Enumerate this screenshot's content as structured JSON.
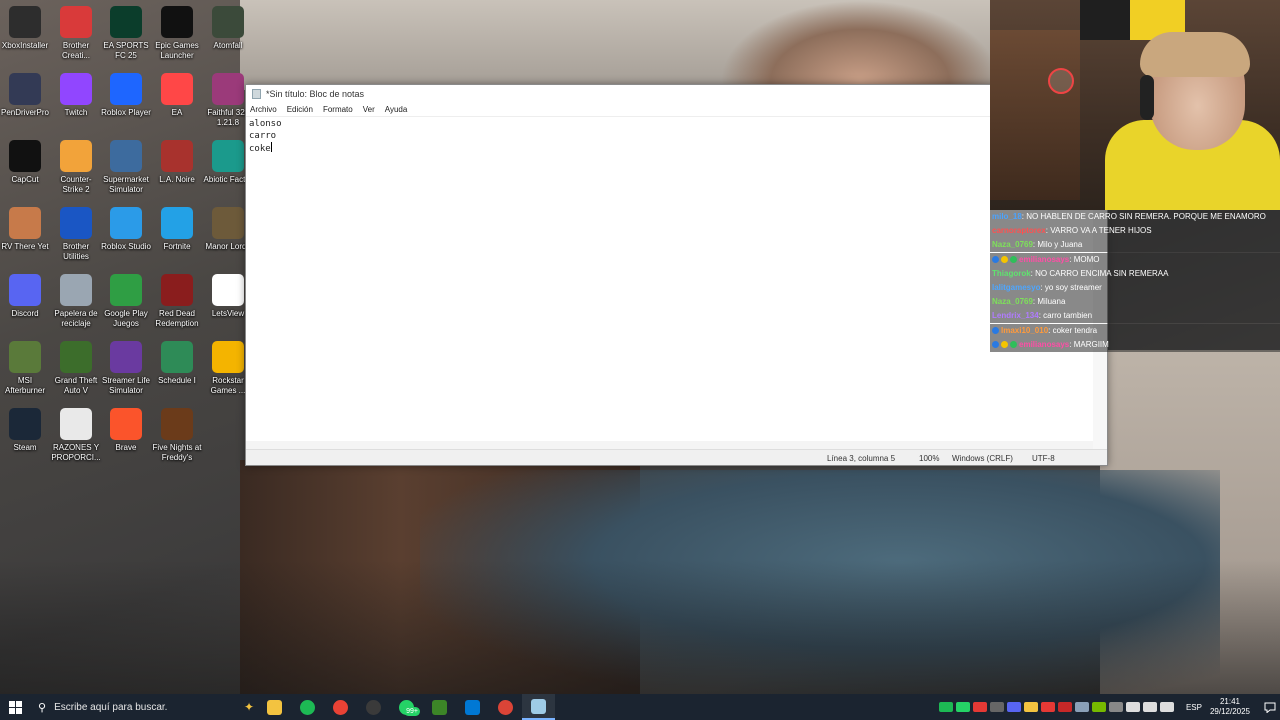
{
  "desktop_icons": [
    {
      "label": "XboxInstaller",
      "icon": "xbox-icon",
      "color": "#2d2d2d"
    },
    {
      "label": "Brother Creati...",
      "icon": "brother-creative-icon",
      "color": "#d93a3a"
    },
    {
      "label": "EA SPORTS FC 25",
      "icon": "ea-fc-icon",
      "color": "#0b3d2b"
    },
    {
      "label": "Epic Games Launcher",
      "icon": "epic-games-icon",
      "color": "#111111"
    },
    {
      "label": "Atomfall",
      "icon": "atomfall-icon",
      "color": "#3b4a3a"
    },
    {
      "label": "PenDriverPro",
      "icon": "unreal-icon",
      "color": "#333a55"
    },
    {
      "label": "Twitch",
      "icon": "twitch-icon",
      "color": "#9146ff"
    },
    {
      "label": "Roblox Player",
      "icon": "roblox-icon",
      "color": "#1e66ff"
    },
    {
      "label": "EA",
      "icon": "ea-icon",
      "color": "#ff4747"
    },
    {
      "label": "Faithful 32x 1.21.8",
      "icon": "winrar-icon",
      "color": "#9b3a7a"
    },
    {
      "label": "CapCut",
      "icon": "capcut-icon",
      "color": "#111111"
    },
    {
      "label": "Counter-Strike 2",
      "icon": "cs2-icon",
      "color": "#f2a33a"
    },
    {
      "label": "Supermarket Simulator",
      "icon": "supermarket-icon",
      "color": "#3d6b9e"
    },
    {
      "label": "L.A. Noire",
      "icon": "la-noire-icon",
      "color": "#a8322d"
    },
    {
      "label": "Abiotic Factor",
      "icon": "abiotic-factor-icon",
      "color": "#1b9a8c"
    },
    {
      "label": "RV There Yet",
      "icon": "rv-there-yet-icon",
      "color": "#c77a4a"
    },
    {
      "label": "Brother Utilities",
      "icon": "brother-utilities-icon",
      "color": "#1a56c4"
    },
    {
      "label": "Roblox Studio",
      "icon": "roblox-studio-icon",
      "color": "#2b9be8"
    },
    {
      "label": "Fortnite",
      "icon": "fortnite-icon",
      "color": "#23a1e6"
    },
    {
      "label": "Manor Lords",
      "icon": "manor-lords-icon",
      "color": "#6d5a3a"
    },
    {
      "label": "Discord",
      "icon": "discord-icon",
      "color": "#5865f2"
    },
    {
      "label": "Papelera de reciclaje",
      "icon": "recycle-bin-icon",
      "color": "#9aa6b2"
    },
    {
      "label": "Google Play Juegos",
      "icon": "google-play-games-icon",
      "color": "#2f9e44"
    },
    {
      "label": "Red Dead Redemption",
      "icon": "red-dead-icon",
      "color": "#8a1d1d"
    },
    {
      "label": "LetsView",
      "icon": "letsview-icon",
      "color": "#ffffff"
    },
    {
      "label": "MSI Afterburner",
      "icon": "msi-afterburner-icon",
      "color": "#5a7a3a"
    },
    {
      "label": "Grand Theft Auto V",
      "icon": "gta-v-icon",
      "color": "#3c6d2b"
    },
    {
      "label": "Streamer Life Simulator",
      "icon": "streamer-life-icon",
      "color": "#6a3aa0"
    },
    {
      "label": "Schedule I",
      "icon": "schedule-i-icon",
      "color": "#2e8b57"
    },
    {
      "label": "Rockstar Games ...",
      "icon": "rockstar-icon",
      "color": "#f4b400"
    },
    {
      "label": "Steam",
      "icon": "steam-icon",
      "color": "#1b2838"
    },
    {
      "label": "RAZONES Y PROPORCI...",
      "icon": "document-icon",
      "color": "#e9e9e9"
    },
    {
      "label": "Brave",
      "icon": "brave-icon",
      "color": "#fb542b"
    },
    {
      "label": "Five Nights at Freddy's",
      "icon": "fnaf-icon",
      "color": "#6b3b1a"
    }
  ],
  "notepad": {
    "title": "*Sin título: Bloc de notas",
    "menu": [
      "Archivo",
      "Edición",
      "Formato",
      "Ver",
      "Ayuda"
    ],
    "lines": [
      "alonso",
      "carro",
      "coke"
    ],
    "status": {
      "position": "Línea 3, columna 5",
      "zoom": "100%",
      "line_ending": "Windows (CRLF)",
      "encoding": "UTF-8"
    }
  },
  "chat": [
    {
      "user": "milo_18",
      "user_color": "#4aa3ff",
      "text": "NO HABLEN DE CARRO SIN REMERA. PORQUE ME ENAMORO",
      "badges": 0
    },
    {
      "user": "carnoraptorex",
      "user_color": "#ff5050",
      "text": "VARRO VA A TENER HIJOS",
      "badges": 0
    },
    {
      "user": "Naza_0769",
      "user_color": "#7ee05a",
      "text": "Milo y Juana",
      "badges": 0
    },
    {
      "user": "emilianosays",
      "user_color": "#ff4da6",
      "text": "MOMO",
      "badges": 3
    },
    {
      "user": "Thiagorok",
      "user_color": "#5fe36f",
      "text": "NO CARRO ENCIMA SIN REMERAA",
      "badges": 0
    },
    {
      "user": "lalitgamesyo",
      "user_color": "#4da6ff",
      "text": "yo soy streamer",
      "badges": 0
    },
    {
      "user": "Naza_0769",
      "user_color": "#7ee05a",
      "text": "Miluana",
      "badges": 0
    },
    {
      "user": "Lendrix_134",
      "user_color": "#b07bff",
      "text": "carro tambien",
      "badges": 0
    },
    {
      "user": "lmaxi10_010",
      "user_color": "#ff9a3c",
      "text": "coker tendra",
      "badges": 1
    },
    {
      "user": "emilianosays",
      "user_color": "#ff4da6",
      "text": "MARGIIM",
      "badges": 3
    }
  ],
  "taskbar": {
    "search_placeholder": "Escribe aquí para buscar.",
    "apps": [
      {
        "icon": "file-explorer-icon",
        "color": "#f3c340"
      },
      {
        "icon": "spotify-icon",
        "color": "#1db954"
      },
      {
        "icon": "chrome-icon",
        "color": "#e94235"
      },
      {
        "icon": "obs-icon",
        "color": "#3a3a3a"
      },
      {
        "icon": "whatsapp-icon",
        "color": "#25d366"
      },
      {
        "icon": "minecraft-icon",
        "color": "#3c8527"
      },
      {
        "icon": "calendar-icon",
        "color": "#0078d4"
      },
      {
        "icon": "chrome-profile-icon",
        "color": "#db4437"
      },
      {
        "icon": "notepad-icon",
        "color": "#9ecbe6"
      }
    ],
    "whatsapp_badge": "99+",
    "tray_icons": [
      {
        "icon": "spotify-tray-icon",
        "color": "#1db954"
      },
      {
        "icon": "whatsapp-tray-icon",
        "color": "#25d366"
      },
      {
        "icon": "red-tray-icon",
        "color": "#e53935"
      },
      {
        "icon": "obs-tray-icon",
        "color": "#666666"
      },
      {
        "icon": "discord-tray-icon",
        "color": "#5865f2"
      },
      {
        "icon": "shield-tray-icon",
        "color": "#f3c340"
      },
      {
        "icon": "app-tray-icon",
        "color": "#e53935"
      },
      {
        "icon": "red-tray-icon-2",
        "color": "#c62828"
      },
      {
        "icon": "steam-tray-icon",
        "color": "#8aa0b8"
      },
      {
        "icon": "nvidia-tray-icon",
        "color": "#76b900"
      },
      {
        "icon": "msi-tray-icon",
        "color": "#888888"
      },
      {
        "icon": "network-tray-icon",
        "color": "#dddddd"
      },
      {
        "icon": "volume-tray-icon",
        "color": "#dddddd"
      },
      {
        "icon": "pen-tray-icon",
        "color": "#dddddd"
      }
    ],
    "language": "ESP",
    "time": "21:41",
    "date": "29/12/2025"
  }
}
